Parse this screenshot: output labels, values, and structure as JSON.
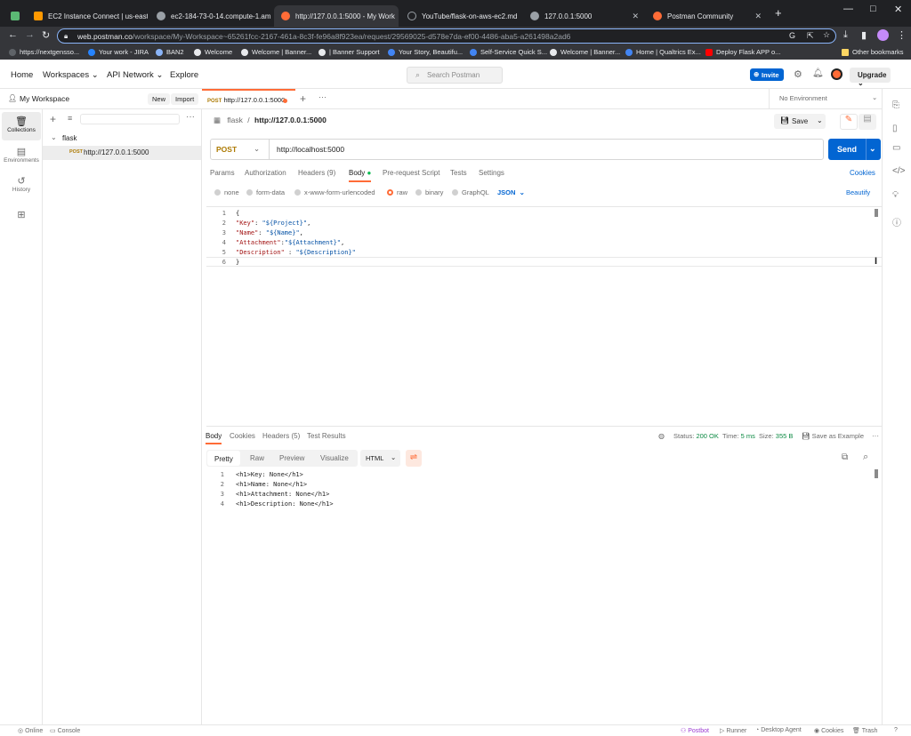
{
  "browser": {
    "tabs": [
      {
        "title": "",
        "color": "#5bb974"
      },
      {
        "title": "EC2 Instance Connect | us-east-",
        "color": "#ff9900"
      },
      {
        "title": "ec2-184-73-0-14.compute-1.am",
        "color": "#9aa0a6"
      },
      {
        "title": "http://127.0.0.1:5000 - My Work",
        "color": "#ff6c37"
      },
      {
        "title": "YouTube/flask-on-aws-ec2.md",
        "color": "#202124"
      },
      {
        "title": "127.0.0.1:5000",
        "color": "#9aa0a6"
      },
      {
        "title": "Postman Community",
        "color": "#ff6c37"
      }
    ],
    "url_host": "web.postman.co",
    "url_path": "/workspace/My-Workspace~65261fcc-2167-461a-8c3f-fe96a8f923ea/request/29569025-d578e7da-ef00-4486-aba5-a261498a2ad6",
    "bookmarks": [
      {
        "label": "https://nextgenssо...",
        "color": "#5f6368"
      },
      {
        "label": "Your work - JIRA",
        "color": "#2684ff"
      },
      {
        "label": "BAN2",
        "color": "#8ab4f8"
      },
      {
        "label": "Welcome",
        "color": "#e8eaed"
      },
      {
        "label": "Welcome | Banner...",
        "color": "#e8eaed"
      },
      {
        "label": "| Banner Support",
        "color": "#e8eaed"
      },
      {
        "label": "Your Story, Beautifu...",
        "color": "#4285f4"
      },
      {
        "label": "Self-Service Quick S...",
        "color": "#4285f4"
      },
      {
        "label": "Welcome | Banner...",
        "color": "#e8eaed"
      },
      {
        "label": "Home | Qualtrics Ex...",
        "color": "#4285f4"
      },
      {
        "label": "Deploy Flask APP o...",
        "color": "#ff0000"
      }
    ],
    "other_bookmarks": "Other bookmarks"
  },
  "header": {
    "nav": [
      "Home",
      "Workspaces",
      "API Network",
      "Explore"
    ],
    "search_placeholder": "Search Postman",
    "invite": "Invite",
    "upgrade": "Upgrade"
  },
  "sidebar": {
    "workspace": "My Workspace",
    "new": "New",
    "import": "Import",
    "rail": [
      "Collections",
      "Environments",
      "History"
    ],
    "collection": "flask",
    "request_method": "POST",
    "request_name": "http://127.0.0.1:5000"
  },
  "request": {
    "tab_method": "POST",
    "tab_title": "http://127.0.0.1:5000",
    "environment": "No Environment",
    "breadcrumb_parent": "flask",
    "breadcrumb_name": "http://127.0.0.1:5000",
    "save": "Save",
    "method": "POST",
    "url": "http://localhost:5000",
    "send": "Send",
    "tabs": [
      "Params",
      "Authorization",
      "Headers (9)",
      "Body",
      "Pre-request Script",
      "Tests",
      "Settings"
    ],
    "cookies": "Cookies",
    "body_types": [
      "none",
      "form-data",
      "x-www-form-urlencoded",
      "raw",
      "binary",
      "GraphQL"
    ],
    "raw_format": "JSON",
    "beautify": "Beautify",
    "body_lines": [
      {
        "n": "1",
        "text": "{"
      },
      {
        "n": "2",
        "key": "\"Key\"",
        "sep": ": ",
        "val": "\"${Project}\"",
        "end": ","
      },
      {
        "n": "3",
        "key": "\"Name\"",
        "sep": ": ",
        "val": "\"${Name}\"",
        "end": ","
      },
      {
        "n": "4",
        "key": "\"Attachment\"",
        "sep": ":",
        "val": "\"${Attachment}\"",
        "end": ","
      },
      {
        "n": "5",
        "key": "\"Description\"",
        "sep": " : ",
        "val": "\"${Description}\"",
        "end": ""
      },
      {
        "n": "6",
        "text": "}"
      }
    ]
  },
  "response": {
    "tabs": [
      "Body",
      "Cookies",
      "Headers (5)",
      "Test Results"
    ],
    "status_label": "Status:",
    "status": "200 OK",
    "time_label": "Time:",
    "time": "5 ms",
    "size_label": "Size:",
    "size": "355 B",
    "save_example": "Save as Example",
    "views": [
      "Pretty",
      "Raw",
      "Preview",
      "Visualize"
    ],
    "format": "HTML",
    "lines": [
      {
        "n": "1",
        "text": "<h1>Key: None</h1>"
      },
      {
        "n": "2",
        "text": "<h1>Name: None</h1>"
      },
      {
        "n": "3",
        "text": "<h1>Attachment: None</h1>"
      },
      {
        "n": "4",
        "text": "<h1>Description: None</h1>"
      }
    ]
  },
  "statusbar": {
    "online": "Online",
    "console": "Console",
    "postbot": "Postbot",
    "runner": "Runner",
    "desktop_agent": "Desktop Agent",
    "cookies": "Cookies",
    "trash": "Trash"
  }
}
